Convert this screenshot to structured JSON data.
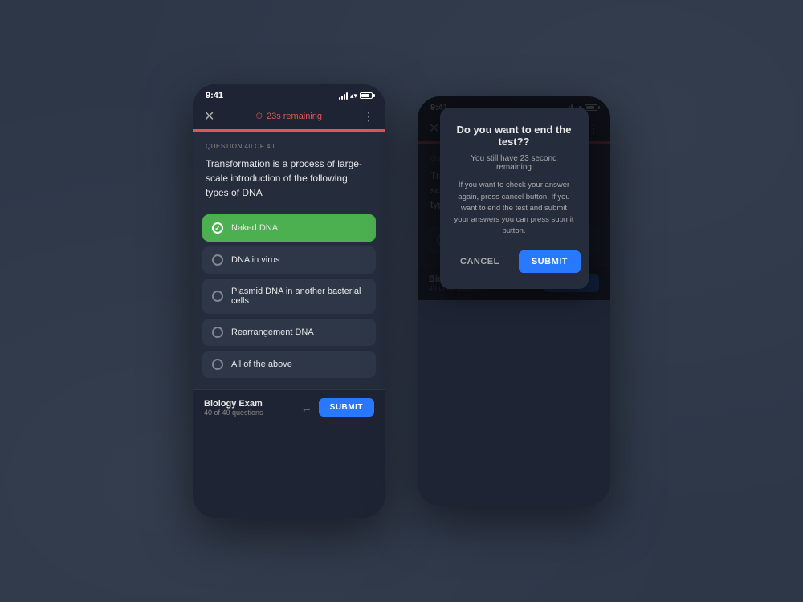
{
  "app": {
    "status_time": "9:41",
    "timer_label": "23s remaining",
    "timer_icon": "⏱",
    "more_icon": "⋮",
    "close_icon": "✕",
    "question_label": "QUESTION 40 OF 40",
    "question_text": "Transformation is a process of large-scale introduction of the following types of DNA",
    "options": [
      {
        "id": "a",
        "text": "Naked DNA",
        "selected": true
      },
      {
        "id": "b",
        "text": "DNA in virus",
        "selected": false
      },
      {
        "id": "c",
        "text": "Plasmid DNA in another bacterial cells",
        "selected": false
      },
      {
        "id": "d",
        "text": "Rearrangement DNA",
        "selected": false
      },
      {
        "id": "e",
        "text": "All of the above",
        "selected": false
      }
    ],
    "exam_title": "Biology Exam",
    "exam_count": "40 of 40 questions",
    "back_icon": "←",
    "submit_label": "SUBMIT",
    "modal": {
      "title": "Do you want to end the test??",
      "subtitle": "You still have 23 second remaining",
      "body": "If you want to check your answer again, press cancel button. If you want to end the test and submit your answers you can press submit button.",
      "cancel_label": "CANCEL",
      "submit_label": "SUBMIT"
    }
  }
}
